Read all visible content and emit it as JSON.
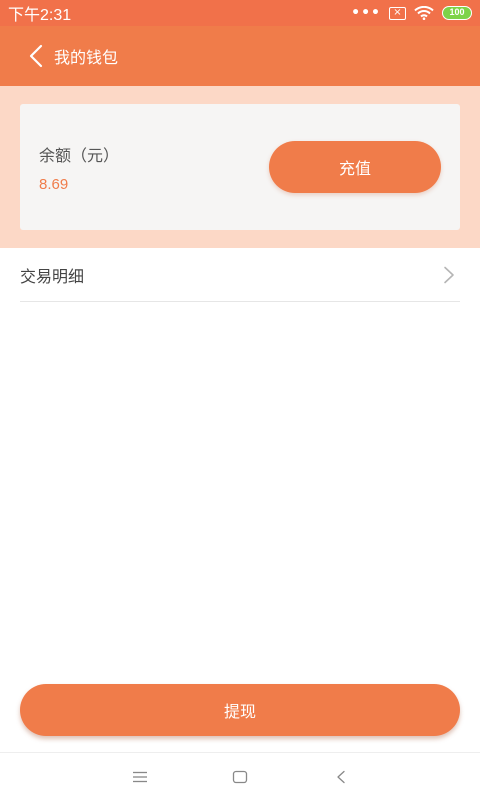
{
  "status_bar": {
    "time": "下午2:31",
    "dots": "•••",
    "battery": "100"
  },
  "app_bar": {
    "title": "我的钱包"
  },
  "wallet": {
    "balance_label": "余额（元）",
    "balance_value": "8.69",
    "recharge_label": "充值"
  },
  "transactions": {
    "label": "交易明细"
  },
  "withdraw": {
    "label": "提现"
  },
  "colors": {
    "status_bar": "#f1714a",
    "primary": "#f07c4a",
    "card_area": "#fcd8c6"
  },
  "icons": {
    "back": "chevron-left-icon",
    "row": "chevron-right-icon",
    "nav_menu": "menu-icon",
    "nav_home": "home-square-icon",
    "nav_back": "back-triangle-icon"
  }
}
